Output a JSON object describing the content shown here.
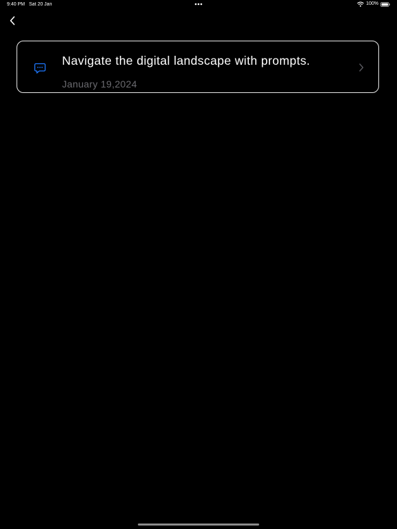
{
  "status_bar": {
    "time": "9:40 PM",
    "date": "Sat 20 Jan",
    "battery": "100%"
  },
  "nav": {
    "back_icon": "chevron-left-icon"
  },
  "chat_item": {
    "icon": "chat-bubble-icon",
    "title": "Navigate the digital landscape with prompts.",
    "date": "January 19,2024",
    "chevron_icon": "chevron-right-icon"
  },
  "colors": {
    "background": "#000000",
    "text_primary": "#ffffff",
    "text_secondary": "#6b6b70",
    "accent": "#1e78ff",
    "card_border": "#e8e8e8"
  }
}
